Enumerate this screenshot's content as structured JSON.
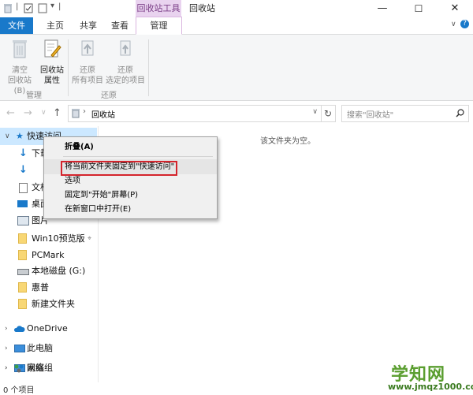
{
  "titlebar": {
    "context_tab_title": "回收站工具",
    "window_title": "回收站",
    "minimize": "—",
    "maximize": "☐",
    "close": "✕"
  },
  "tabs": {
    "file": "文件",
    "home": "主页",
    "share": "共享",
    "view": "查看",
    "manage": "管理"
  },
  "ribbon": {
    "empty_bin": "清空\n回收站(B)",
    "bin_props": "回收站\n属性",
    "restore_all": "还原\n所有项目",
    "restore_sel": "还原\n选定的项目",
    "group_manage": "管理",
    "group_restore": "还原"
  },
  "address": {
    "path": "回收站",
    "search_placeholder": "搜索\"回收站\""
  },
  "navpane": {
    "quick_access": "快速访问",
    "items": [
      {
        "label": "下载"
      },
      {
        "label": ""
      },
      {
        "label": "文档"
      },
      {
        "label": "桌面"
      },
      {
        "label": "图片"
      },
      {
        "label": "Win10预览版"
      },
      {
        "label": "PCMark"
      },
      {
        "label": "本地磁盘 (G:)"
      },
      {
        "label": "惠普"
      },
      {
        "label": "新建文件夹"
      }
    ],
    "onedrive": "OneDrive",
    "this_pc": "此电脑",
    "network": "网络",
    "homegroup": "家庭组"
  },
  "content": {
    "empty_message": "该文件夹为空。"
  },
  "context_menu": {
    "collapse": "折叠(A)",
    "pin_quick_access": "将当前文件夹固定到\"快速访问\"",
    "options": "选项",
    "pin_start": "固定到\"开始\"屏幕(P)",
    "open_new_window": "在新窗口中打开(E)"
  },
  "statusbar": {
    "item_count": "0 个项目"
  },
  "watermark": {
    "brand": "学知网",
    "url": "www.jmqz1000.com"
  },
  "colors": {
    "file_tab": "#1979ca",
    "context_tab": "#e9d3ef",
    "selection": "#cce8ff",
    "highlight_box": "#d4242c",
    "watermark": "#5a9e2f"
  }
}
